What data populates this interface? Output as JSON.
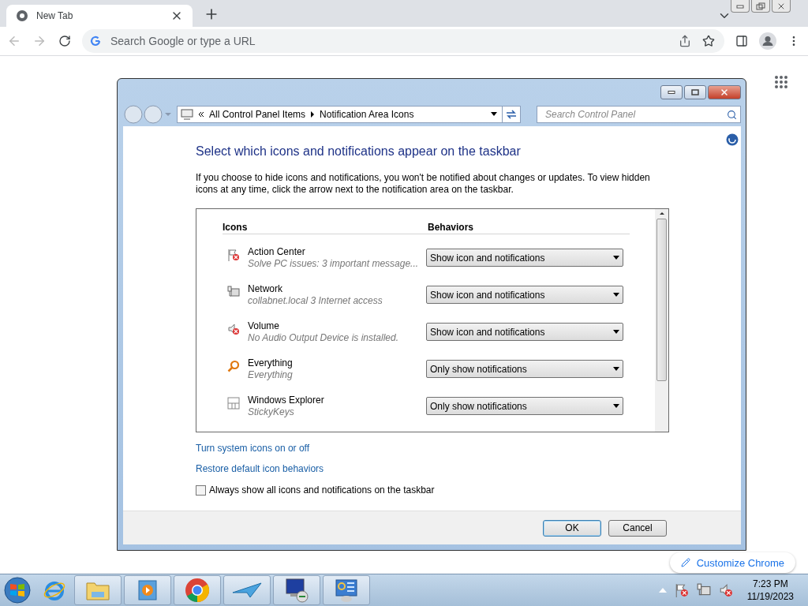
{
  "browser": {
    "tab": {
      "title": "New Tab"
    },
    "address_bar": {
      "placeholder": "Search Google or type a URL"
    },
    "customize_button": {
      "label": "Customize Chrome"
    }
  },
  "dialog": {
    "breadcrumb": [
      "All Control Panel Items",
      "Notification Area Icons"
    ],
    "search": {
      "placeholder": "Search Control Panel"
    },
    "heading": "Select which icons and notifications appear on the taskbar",
    "description": "If you choose to hide icons and notifications, you won't be notified about changes or updates. To view hidden icons at any time, click the arrow next to the notification area on the taskbar.",
    "columns": [
      "Icons",
      "Behaviors"
    ],
    "rows": [
      {
        "kind": "flag",
        "name": "Action Center",
        "detail": "Solve PC issues: 3 important message...",
        "behavior": "Show icon and notifications"
      },
      {
        "kind": "network",
        "name": "Network",
        "detail": "collabnet.local  3 Internet access",
        "behavior": "Show icon and notifications"
      },
      {
        "kind": "speaker",
        "name": "Volume",
        "detail": "No Audio Output Device is installed.",
        "behavior": "Show icon and notifications"
      },
      {
        "kind": "magnifier",
        "name": "Everything",
        "detail": "Everything",
        "behavior": "Only show notifications"
      },
      {
        "kind": "window",
        "name": "Windows Explorer",
        "detail": "StickyKeys",
        "behavior": "Only show notifications"
      }
    ],
    "links": [
      "Turn system icons on or off",
      "Restore default icon behaviors"
    ],
    "checkbox": {
      "label": "Always show all icons and notifications on the taskbar",
      "checked": false
    },
    "buttons": [
      {
        "label": "OK",
        "default": true
      },
      {
        "label": "Cancel",
        "default": false
      }
    ]
  },
  "taskbar": {
    "tray": {
      "time": "7:23 PM",
      "date": "11/19/2023"
    }
  }
}
